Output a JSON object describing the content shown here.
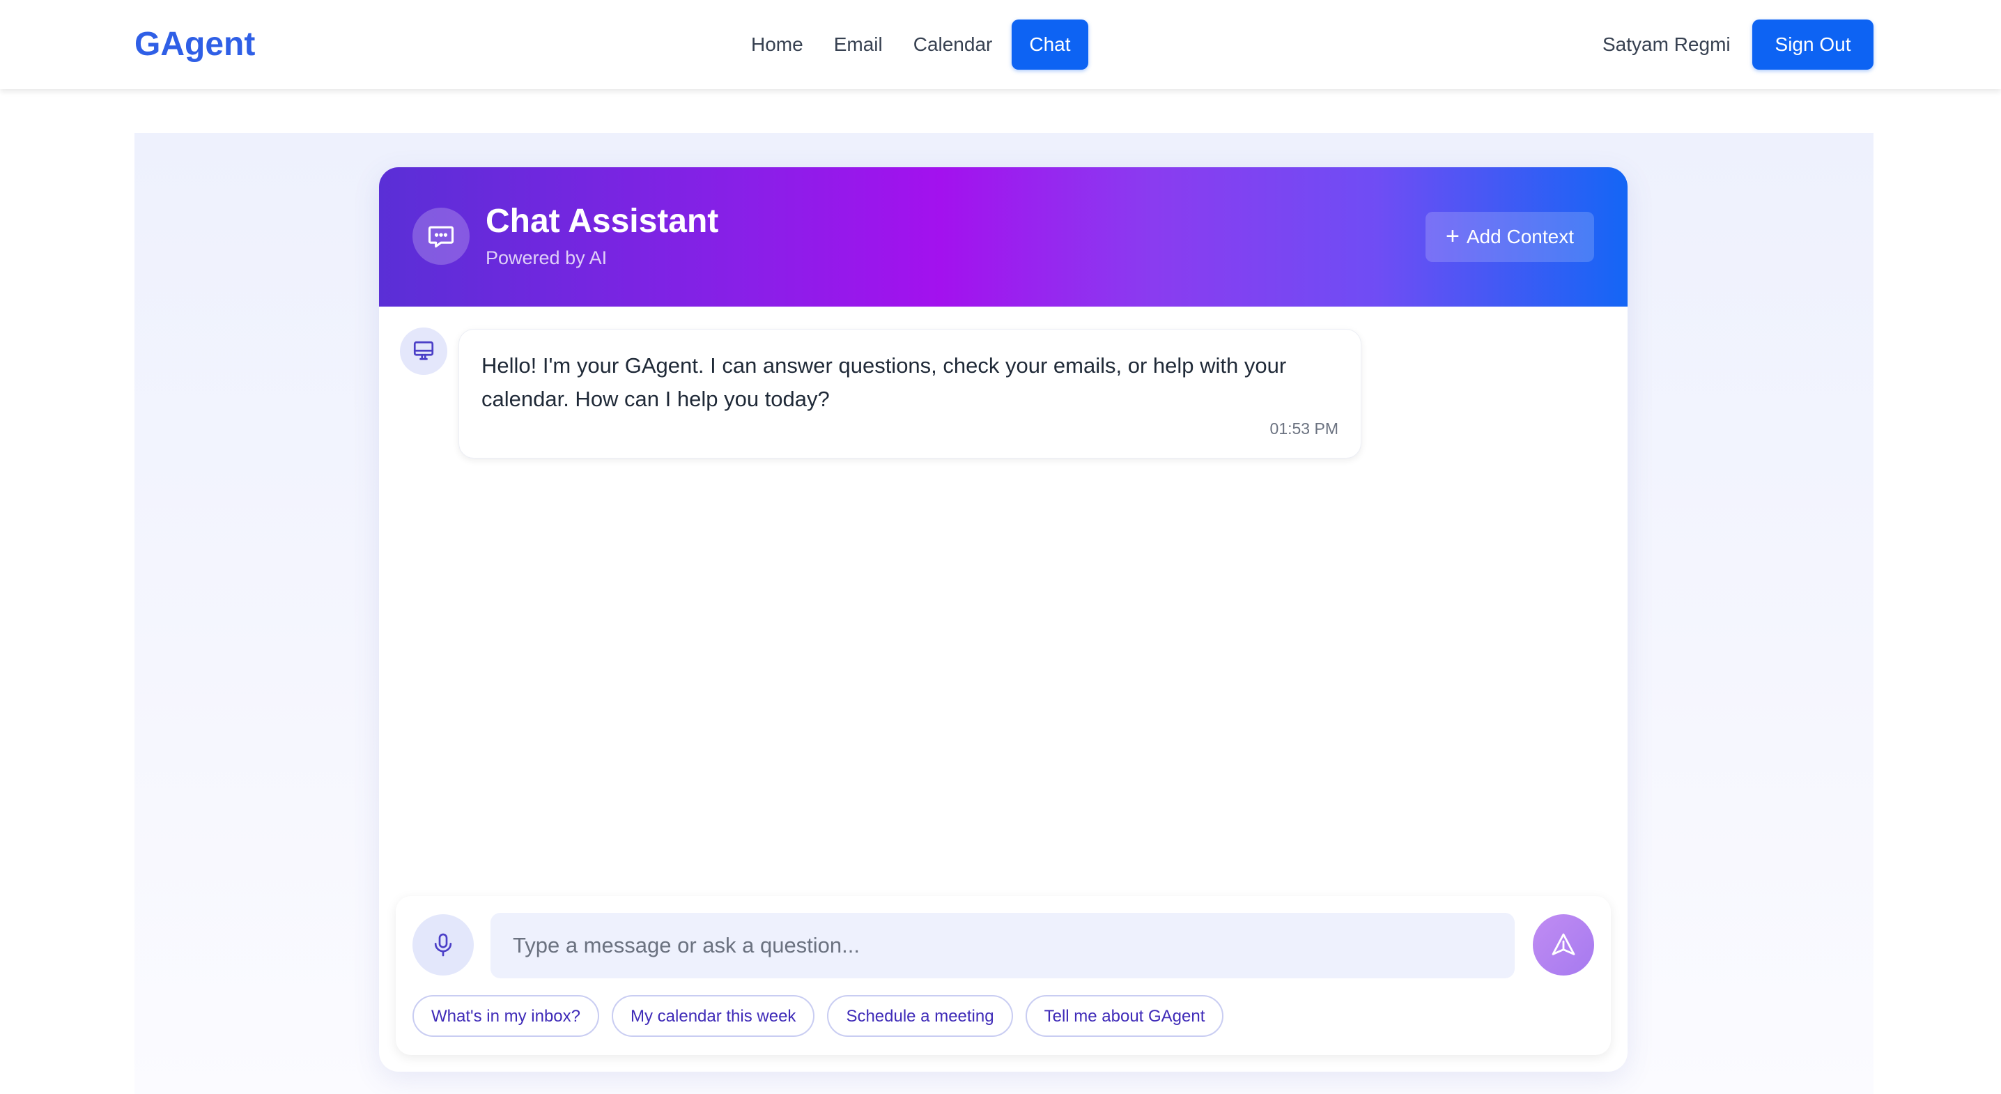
{
  "navbar": {
    "brand": "GAgent",
    "links": [
      {
        "label": "Home",
        "active": false
      },
      {
        "label": "Email",
        "active": false
      },
      {
        "label": "Calendar",
        "active": false
      },
      {
        "label": "Chat",
        "active": true
      }
    ],
    "user_name": "Satyam Regmi",
    "signout_label": "Sign Out"
  },
  "chat": {
    "title": "Chat Assistant",
    "subtitle": "Powered by AI",
    "add_context_label": "Add Context",
    "messages": [
      {
        "sender": "bot",
        "text": "Hello! I'm your GAgent. I can answer questions, check your emails, or help with your calendar. How can I help you today?",
        "time": "01:53 PM"
      }
    ],
    "input": {
      "placeholder": "Type a message or ask a question...",
      "value": ""
    },
    "suggestions": [
      "What's in my inbox?",
      "My calendar this week",
      "Schedule a meeting",
      "Tell me about GAgent"
    ]
  },
  "icons": {
    "header": "chat-bubble-icon",
    "bot_avatar": "monitor-icon",
    "mic": "microphone-icon",
    "send": "send-icon",
    "add": "plus-icon"
  },
  "colors": {
    "brand": "#2f5fe6",
    "primary": "#0d63f3",
    "header_gradient_start": "#5a2fd6",
    "header_gradient_mid": "#a311ee",
    "header_gradient_end": "#1466f5",
    "chip_text": "#3f2bb8"
  }
}
